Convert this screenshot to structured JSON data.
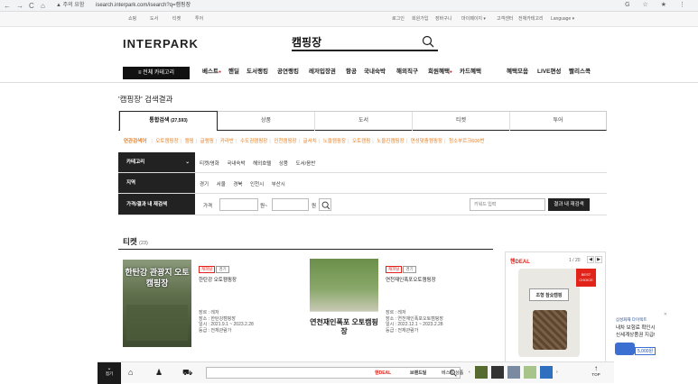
{
  "browser": {
    "nav_back": "←",
    "nav_forward": "→",
    "nav_reload": "C",
    "home": "⌂",
    "warning": "▲ 주의 요함",
    "url": "isearch.interpark.com/isearch?q=캠핑장",
    "right_icons": "G ☆ ★ ⋮"
  },
  "util": {
    "left_items": [
      "투어",
      "티켓",
      "도서",
      "쇼핑"
    ],
    "right_items": [
      "로그인",
      "회원가입",
      "장바구니",
      "마이페이지 ▾",
      "고객센터",
      "전체카테고리",
      "Language ▾"
    ]
  },
  "header": {
    "logo": "INTERPARK",
    "search_value": "캠핑장"
  },
  "gnb": {
    "all_category": "≡ 전체 카테고리",
    "items": [
      "베스트",
      "핸딜",
      "도서랭킹",
      "공연랭킹",
      "레저입장권",
      "항공",
      "국내숙박",
      "해외직구",
      "회원혜택",
      "카드혜택"
    ],
    "right_items": [
      "혜택모음",
      "LIVE편성",
      "빨리스콕"
    ]
  },
  "page_title": "'캠핑장' 검색결과",
  "tabs": [
    {
      "label": "통합검색",
      "count": "(27,593)"
    },
    {
      "label": "상품"
    },
    {
      "label": "도서"
    },
    {
      "label": "티켓"
    },
    {
      "label": "투어"
    }
  ],
  "related": {
    "label": "연관검색어",
    "items": [
      "오토캠핑장",
      "캠핑",
      "글램핑",
      "카라반",
      "수도권캠핑장",
      "인천캠핑장",
      "글서치",
      "노을캠핑장",
      "오토캠핑",
      "노을진캠핑장",
      "연성맞춤캠핑장",
      "청소부르크600번"
    ]
  },
  "filters": {
    "category": {
      "label": "카테고리",
      "chevron": "⌄",
      "options": [
        "티켓/영화",
        "국내숙박",
        "해외호텔",
        "상품",
        "도서/음반"
      ]
    },
    "region": {
      "label": "지역",
      "options": [
        "경기",
        "서울",
        "경북",
        "인천시",
        "부산시"
      ]
    },
    "price": {
      "label": "가격/결과 내 재검색",
      "price_label": "가격",
      "unit_from": "원~",
      "unit_to": "원",
      "keyword_placeholder": "키워드 입력",
      "research_button": "결과 내 재검색"
    }
  },
  "tickets": {
    "heading": "티켓",
    "count": "(23)",
    "cards": [
      {
        "image_text": "한탄강 관광지 오토캠핑장",
        "badges": [
          "캐피탈",
          "경기"
        ],
        "title": "한탄강 오토캠핑장",
        "details": [
          "장르 : 레저",
          "장소 : 한탄강캠핑장",
          "일시 : 2021.9.1 ~ 2023.2.28",
          "등급 : 전체관람가"
        ]
      },
      {
        "image_text": "연천재인폭포 오토캠핑장",
        "image_subtext": "",
        "badges": [
          "캐피탈",
          "경기"
        ],
        "title": "연천재인폭포오토캠핑장",
        "details": [
          "장르 : 레저",
          "장소 : 연천재인폭포오토캠핑장",
          "일시 : 2022.12.1 ~ 2023.2.28",
          "등급 : 전체관람가"
        ]
      }
    ]
  },
  "ad": {
    "brand": "핸DEAL",
    "pager": "1 / 20",
    "badge": "BEST CHOICE",
    "product_text": "조형 참숯캠핑"
  },
  "side_ad": {
    "brand": "삼성화재 다이렉트",
    "line1": "내차 보험료 확인시",
    "line2": "신세계상품권 지급!",
    "amount": "5,000원",
    "close": "✕"
  },
  "bottom": {
    "menu_label": "접기",
    "handeal": "핸DEAL",
    "brandday": "브랜드딜",
    "best": "베스트 상품",
    "top": "TOP"
  },
  "colors": {
    "accent": "#e2231a",
    "related": "#e67e22",
    "dark": "#222222"
  }
}
